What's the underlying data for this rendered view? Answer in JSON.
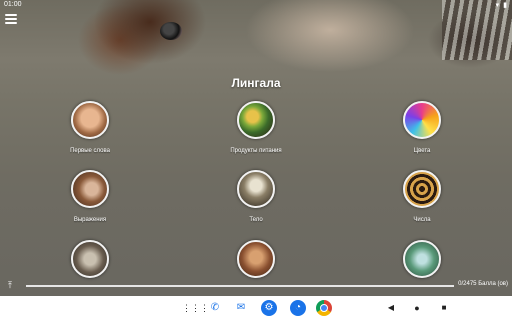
{
  "status_bar": {
    "time": "01:00",
    "icons": [
      "wifi-icon",
      "battery-icon"
    ]
  },
  "header": {
    "menu_icon": "hamburger-icon",
    "title": "Лингала"
  },
  "categories": [
    {
      "label": "Первые слова",
      "icon": "baby-face-image"
    },
    {
      "label": "Продукты питания",
      "icon": "food-plate-image"
    },
    {
      "label": "Цвета",
      "icon": "color-paint-image"
    },
    {
      "label": "Выражения",
      "icon": "pointing-hand-image"
    },
    {
      "label": "Тело",
      "icon": "skeleton-image"
    },
    {
      "label": "Числа",
      "icon": "snake-numbers-image"
    },
    {
      "label": "",
      "icon": "frog-image"
    },
    {
      "label": "",
      "icon": "child-image"
    },
    {
      "label": "",
      "icon": "nature-image"
    }
  ],
  "progress": {
    "icon": "upload-icon",
    "fraction": 0.0,
    "text": "0/2475 Балла (ов)",
    "colors": {
      "track": "#e6e6e6",
      "fill": "#5aa0ff"
    }
  },
  "nav_bar": {
    "apps": "apps-grid-icon",
    "dock": [
      "phone-icon",
      "messages-icon",
      "settings-icon",
      "clock-icon",
      "chrome-icon"
    ],
    "controls": [
      "back-icon",
      "home-icon",
      "recents-icon"
    ]
  }
}
